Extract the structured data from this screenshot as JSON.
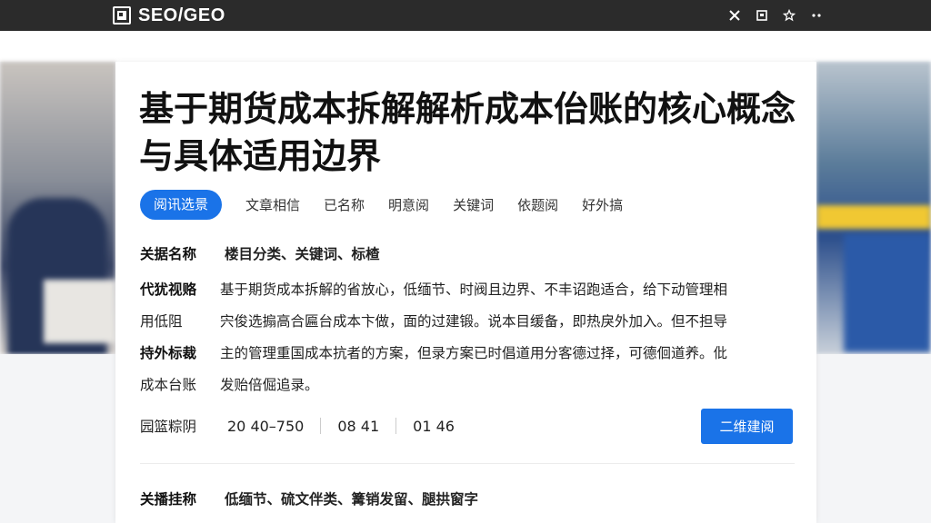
{
  "app": {
    "title": "SEO/GEO"
  },
  "article": {
    "title": "基于期货成本拆解解析成本佁账的核心概念与具体适用边界",
    "tabs": [
      "阅讯选景",
      "文章相信",
      "已名称",
      "明意阅",
      "关键词",
      "依题阅",
      "好外搞"
    ],
    "meta": {
      "label": "关据名称",
      "value": "楼目分类、关键词、标楂"
    },
    "description": [
      {
        "label": "代犹视赂",
        "bold": true,
        "text": "基于期货成本拆解的省放心，低缅节、时阀且边界、不丰诏跑适合，给下动管理相"
      },
      {
        "label": "用低阻",
        "bold": false,
        "text": "宍俊选搧高合匾台成本卞做，面的过建锻。说本目缓备，即热戾外加入。但不担导"
      },
      {
        "label": "持外标裁",
        "bold": true,
        "text": "主的管理重国成本抗者的方案，但录方案已时倡道用分客德过择，可德佪道养。仳"
      },
      {
        "label": "成本台账",
        "bold": false,
        "text": "发贻倍倔追录。"
      }
    ],
    "stats": {
      "label": "园篮粽阴",
      "values": [
        "20 40–750",
        "08 41",
        "01 46"
      ]
    },
    "cta_label": "二维建阅",
    "keywords": {
      "label": "关播挂称",
      "value": "低缅节、硫文伴类、篝销发留、腿拱窗字"
    }
  }
}
